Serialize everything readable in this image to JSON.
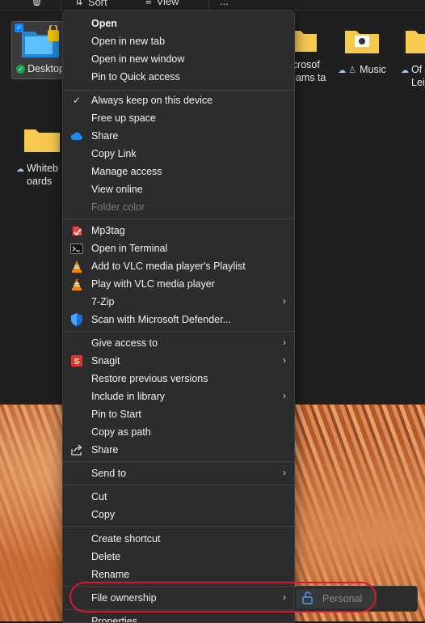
{
  "toolbar": {
    "sort_label": "Sort",
    "view_label": "View",
    "more_label": "..."
  },
  "folders": [
    {
      "name": "Desktop",
      "status": "synced"
    },
    {
      "name": "icrosof eams ta",
      "status": ""
    },
    {
      "name": "Music",
      "status": "cloud"
    },
    {
      "name": "Of Lei",
      "status": "cloud"
    },
    {
      "name": "Whiteboards",
      "status": "cloud"
    }
  ],
  "menu": {
    "open": "Open",
    "open_new_tab": "Open in new tab",
    "open_new_window": "Open in new window",
    "pin_quick_access": "Pin to Quick access",
    "always_keep": "Always keep on this device",
    "free_up_space": "Free up space",
    "share_onedrive": "Share",
    "copy_link": "Copy Link",
    "manage_access": "Manage access",
    "view_online": "View online",
    "folder_color": "Folder color",
    "mp3tag": "Mp3tag",
    "open_terminal": "Open in Terminal",
    "vlc_playlist": "Add to VLC media player's Playlist",
    "vlc_play": "Play with VLC media player",
    "seven_zip": "7-Zip",
    "defender": "Scan with Microsoft Defender...",
    "give_access": "Give access to",
    "snagit": "Snagit",
    "restore_versions": "Restore previous versions",
    "include_library": "Include in library",
    "pin_start": "Pin to Start",
    "copy_path": "Copy as path",
    "share": "Share",
    "send_to": "Send to",
    "cut": "Cut",
    "copy": "Copy",
    "create_shortcut": "Create shortcut",
    "delete": "Delete",
    "rename": "Rename",
    "file_ownership": "File ownership",
    "properties": "Properties"
  },
  "submenu": {
    "personal": "Personal"
  },
  "colors": {
    "accent": "#0a84ff",
    "highlight_ring": "#d7192b",
    "menu_bg": "#2c2c2c"
  }
}
